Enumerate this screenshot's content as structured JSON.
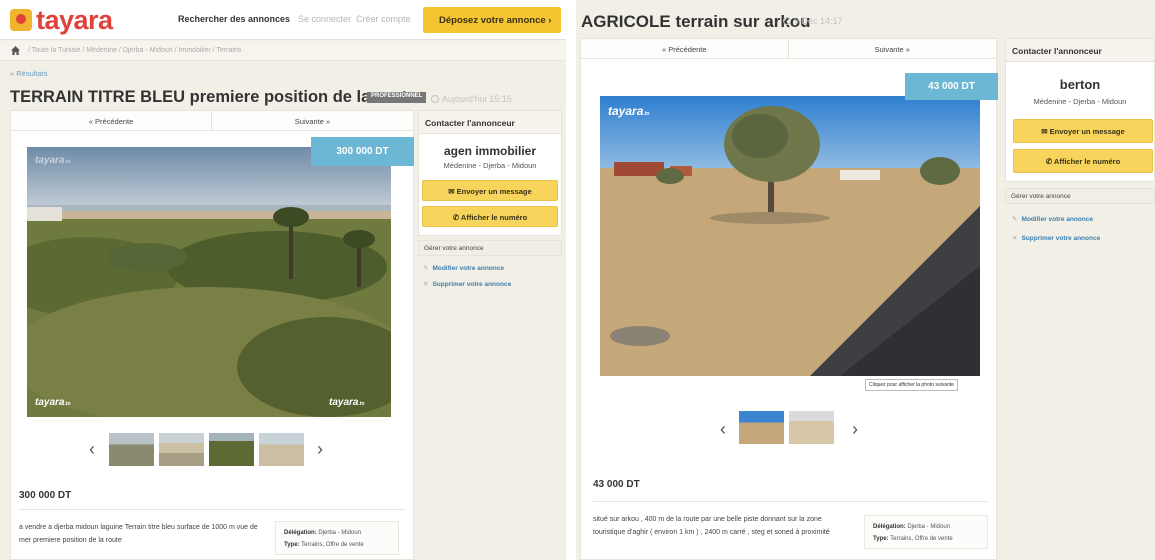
{
  "left_listing": {
    "logo": "tayara",
    "nav": {
      "search": "Rechercher des annonces",
      "login": "Se connecter",
      "signup": "Créer compte",
      "deposit_button": "Déposez votre annonce  ›"
    },
    "breadcrumb": "/  Toute la Tunisie  /  Médenine  /  Djerba - Midoun  /  Immobilier  /  Terrains",
    "results_link": "« Résultats",
    "title": "TERRAIN TITRE BLEU premiere position de la route",
    "badge": "PROFESSIONNEL",
    "date": "Aujourd'hui 15:15",
    "prev": "« Précédente",
    "next": "Suivante »",
    "price_tag": "300 000 DT",
    "watermark": "tayara",
    "watermark_suffix": ".tn",
    "price": "300 000 DT",
    "description": "a vendre a djerba midoun laguine Terrain titre bleu surface de 1000 m vue de mer premiere position de la route",
    "details": {
      "delegation_label": "Délégation:",
      "delegation_value": "Djerba - Midoun",
      "type_label": "Type:",
      "type_value": "Terrains, Offre de vente"
    },
    "contact": {
      "header": "Contacter l'annonceur",
      "name": "agen immobilier",
      "location": "Médenine - Djerba - Midoun",
      "message_button": "Envoyer un message",
      "phone_button": "Afficher le numéro"
    },
    "manage": {
      "header": "Gérer votre annonce",
      "edit": "Modifier votre annonce",
      "delete": "Supprimer votre annonce"
    }
  },
  "right_listing": {
    "title": "AGRICOLE terrain sur arkou",
    "date": "9 Déc 14:17",
    "prev": "« Précédente",
    "next": "Suivante »",
    "price_tag": "43 000 DT",
    "watermark": "tayara",
    "watermark_suffix": ".tn",
    "tooltip": "Cliquez pour afficher la photo suivante",
    "price": "43 000 DT",
    "description": "situé sur arkou , 400 m de la route par une belle piste donnant sur la zone touristique d'aghir ( environ 1 km ) , 2400 m carré , steg et soned à proximité",
    "details": {
      "delegation_label": "Délégation:",
      "delegation_value": "Djerba - Midoun",
      "type_label": "Type:",
      "type_value": "Terrains, Offre de vente"
    },
    "contact": {
      "header": "Contacter l'annonceur",
      "name": "berton",
      "location": "Médenine - Djerba - Midoun",
      "message_button": "Envoyer un message",
      "phone_button": "Afficher le numéro"
    },
    "manage": {
      "header": "Gérer votre annonce",
      "edit": "Modifier votre annonce",
      "delete": "Supprimer votre annonce"
    }
  },
  "colors": {
    "brand_red": "#e0413a",
    "price_tag_blue": "#6bb7d4",
    "button_yellow": "#f7d55c",
    "link_blue": "#3f7fae"
  }
}
